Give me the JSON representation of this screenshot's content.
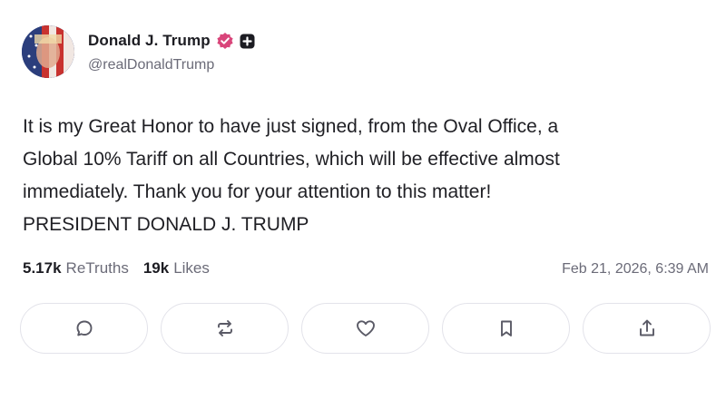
{
  "author": {
    "display_name": "Donald J. Trump",
    "handle": "@realDonaldTrump",
    "verified_icon": "verified-badge-icon",
    "plus_icon": "plus-badge-icon"
  },
  "post": {
    "lines": [
      "It is my Great Honor to have just signed, from the Oval Office, a",
      "Global 10% Tariff on all Countries, which will be effective almost",
      "immediately. Thank you for your attention to this matter!",
      "PRESIDENT DONALD J. TRUMP"
    ],
    "retruths_count": "5.17k",
    "retruths_label": "ReTruths",
    "likes_count": "19k",
    "likes_label": "Likes",
    "timestamp": "Feb 21, 2026, 6:39 AM"
  },
  "actions": [
    {
      "icon": "comment-icon"
    },
    {
      "icon": "retruth-icon"
    },
    {
      "icon": "like-heart-icon"
    },
    {
      "icon": "bookmark-icon"
    },
    {
      "icon": "share-icon"
    }
  ],
  "colors": {
    "text": "#1f1f24",
    "muted": "#6b6b78",
    "verified": "#d9457a",
    "border": "#e3e3ea"
  }
}
